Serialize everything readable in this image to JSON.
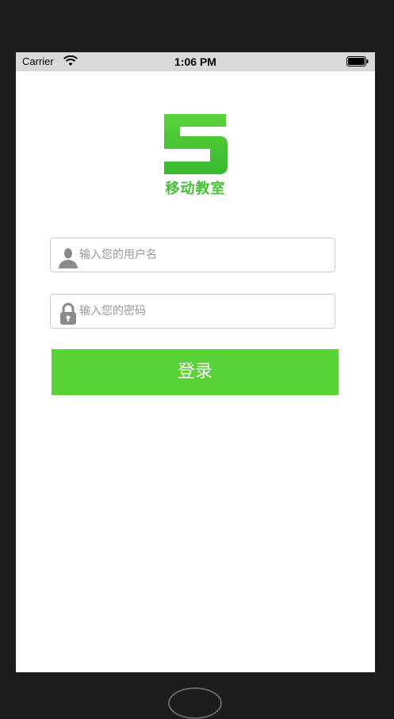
{
  "status_bar": {
    "carrier": "Carrier",
    "time": "1:06 PM",
    "wifi_icon": "wifi-icon",
    "battery_icon": "battery-icon"
  },
  "logo": {
    "mark": "5",
    "text": "移动教室",
    "color": "#45c135"
  },
  "login_form": {
    "username": {
      "icon": "user-icon",
      "value": "",
      "placeholder": "输入您的用户名"
    },
    "password": {
      "icon": "lock-icon",
      "value": "",
      "placeholder": "输入您的密码"
    },
    "submit_label": "登录",
    "accent_color": "#58d335"
  }
}
